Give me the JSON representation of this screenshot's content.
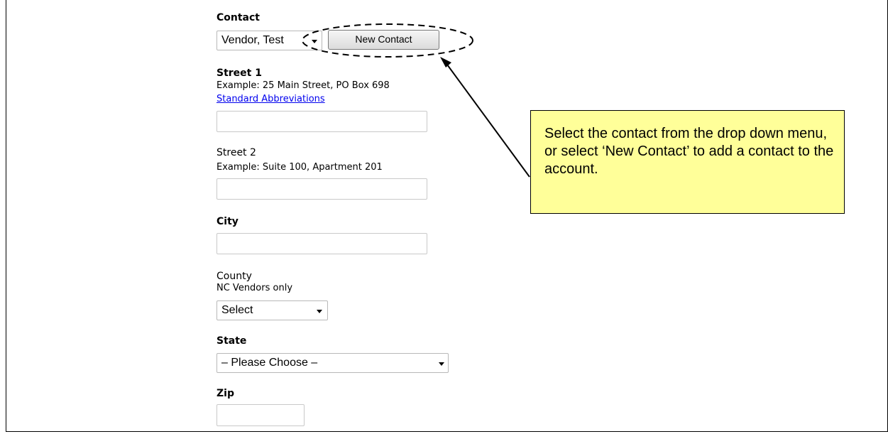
{
  "form": {
    "contact": {
      "label": "Contact",
      "selected": "Vendor, Test",
      "new_button": "New Contact"
    },
    "street1": {
      "label": "Street 1",
      "example": "Example: 25 Main Street, PO Box 698",
      "link": "Standard Abbreviations",
      "value": ""
    },
    "street2": {
      "label": "Street 2",
      "example": "Example: Suite 100, Apartment 201",
      "value": ""
    },
    "city": {
      "label": "City",
      "value": ""
    },
    "county": {
      "label": "County",
      "note": "NC Vendors only",
      "selected": "Select"
    },
    "state": {
      "label": "State",
      "selected": "– Please Choose –"
    },
    "zip": {
      "label": "Zip",
      "value": ""
    }
  },
  "callout": {
    "text": "Select the contact from the drop down menu, or select ‘New Contact’ to add a contact to the account.",
    "background": "#ffff99"
  }
}
